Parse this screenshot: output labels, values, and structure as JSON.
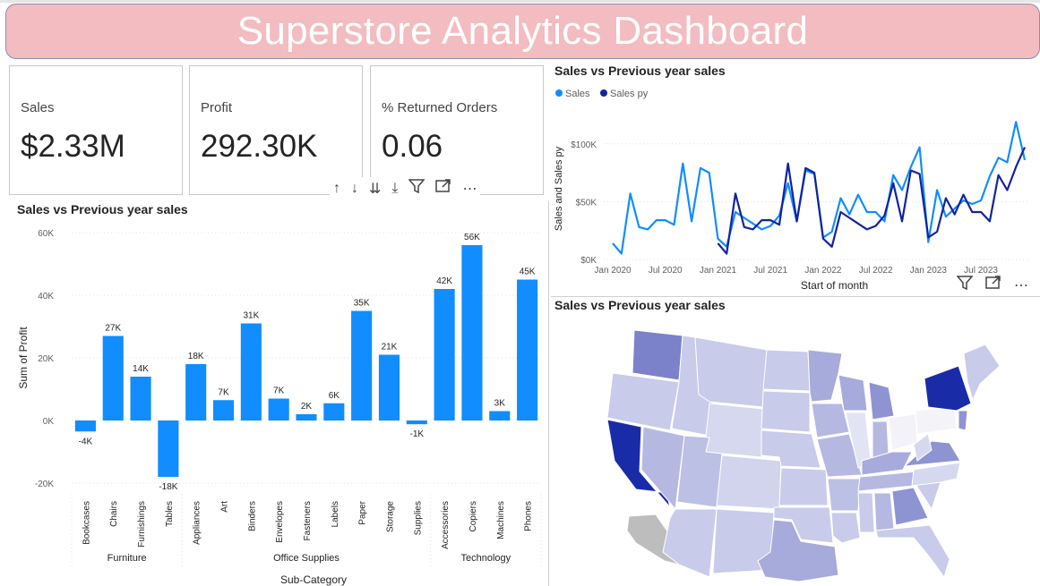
{
  "title": "Superstore Analytics Dashboard",
  "kpis": [
    {
      "label": "Sales",
      "value": "$2.33M"
    },
    {
      "label": "Profit",
      "value": "292.30K"
    },
    {
      "label": "% Returned Orders",
      "value": "0.06"
    }
  ],
  "bar_panel": {
    "title": "Sales vs Previous year sales"
  },
  "line_panel": {
    "title": "Sales vs Previous year sales"
  },
  "map_panel": {
    "title": "Sales vs Previous year sales"
  },
  "colors": {
    "sales": "#118dff",
    "sales_py": "#12239e",
    "title_bg": "#f2bcc1"
  },
  "chart_data": [
    {
      "type": "bar",
      "title": "Sales vs Previous year sales",
      "xlabel": "Sub-Category",
      "ylabel": "Sum of Profit",
      "ylim": [
        -20000,
        60000
      ],
      "yticks": [
        60000,
        40000,
        20000,
        0,
        -20000
      ],
      "ytick_labels": [
        "60K",
        "40K",
        "20K",
        "0K",
        "-20K"
      ],
      "groups": [
        {
          "name": "Furniture",
          "categories": [
            "Bookcases",
            "Chairs",
            "Furnishings",
            "Tables"
          ]
        },
        {
          "name": "Office Supplies",
          "categories": [
            "Appliances",
            "Art",
            "Binders",
            "Envelopes",
            "Fasteners",
            "Labels",
            "Paper",
            "Storage",
            "Supplies"
          ]
        },
        {
          "name": "Technology",
          "categories": [
            "Accessories",
            "Copiers",
            "Machines",
            "Phones"
          ]
        }
      ],
      "categories": [
        "Bookcases",
        "Chairs",
        "Furnishings",
        "Tables",
        "Appliances",
        "Art",
        "Binders",
        "Envelopes",
        "Fasteners",
        "Labels",
        "Paper",
        "Storage",
        "Supplies",
        "Accessories",
        "Copiers",
        "Machines",
        "Phones"
      ],
      "values": [
        -3500,
        27000,
        14000,
        -18000,
        18000,
        6500,
        31000,
        7000,
        2000,
        5500,
        35000,
        21000,
        -1200,
        42000,
        56000,
        3000,
        45000
      ],
      "data_labels": [
        "-4K",
        "27K",
        "14K",
        "-18K",
        "18K",
        "7K",
        "31K",
        "7K",
        "2K",
        "6K",
        "35K",
        "21K",
        "-1K",
        "42K",
        "56K",
        "3K",
        "45K"
      ],
      "grid": true
    },
    {
      "type": "line",
      "title": "Sales vs Previous year sales",
      "xlabel": "Start of month",
      "ylabel": "Sales and Sales py",
      "ylim": [
        0,
        130000
      ],
      "yticks": [
        0,
        50000,
        100000
      ],
      "ytick_labels": [
        "$0K",
        "$50K",
        "$100K"
      ],
      "xtick_labels": [
        "Jan 2020",
        "Jul 2020",
        "Jan 2021",
        "Jul 2021",
        "Jan 2022",
        "Jul 2022",
        "Jan 2023",
        "Jul 2023"
      ],
      "legend": "top-left",
      "series": [
        {
          "name": "Sales",
          "start": "2020-01",
          "values": [
            14000,
            5000,
            57000,
            28000,
            26000,
            34000,
            34000,
            30000,
            83000,
            33000,
            79000,
            75000,
            18000,
            11000,
            41000,
            36000,
            31000,
            26000,
            29000,
            38000,
            66000,
            33000,
            77000,
            74000,
            19000,
            24000,
            53000,
            39000,
            56000,
            41000,
            41000,
            33000,
            73000,
            60000,
            80000,
            97000,
            15000,
            60000,
            37000,
            44000,
            51000,
            48000,
            51000,
            72000,
            88000,
            84000,
            119000,
            86000
          ]
        },
        {
          "name": "Sales py",
          "start": "2020-01",
          "values": [
            null,
            null,
            null,
            null,
            null,
            null,
            null,
            null,
            null,
            null,
            null,
            null,
            14000,
            5000,
            57000,
            28000,
            26000,
            34000,
            34000,
            30000,
            83000,
            33000,
            79000,
            75000,
            18000,
            11000,
            41000,
            36000,
            31000,
            26000,
            29000,
            38000,
            66000,
            33000,
            77000,
            74000,
            19000,
            24000,
            53000,
            39000,
            56000,
            41000,
            41000,
            33000,
            73000,
            60000,
            80000,
            97000
          ]
        }
      ],
      "grid": true
    }
  ]
}
